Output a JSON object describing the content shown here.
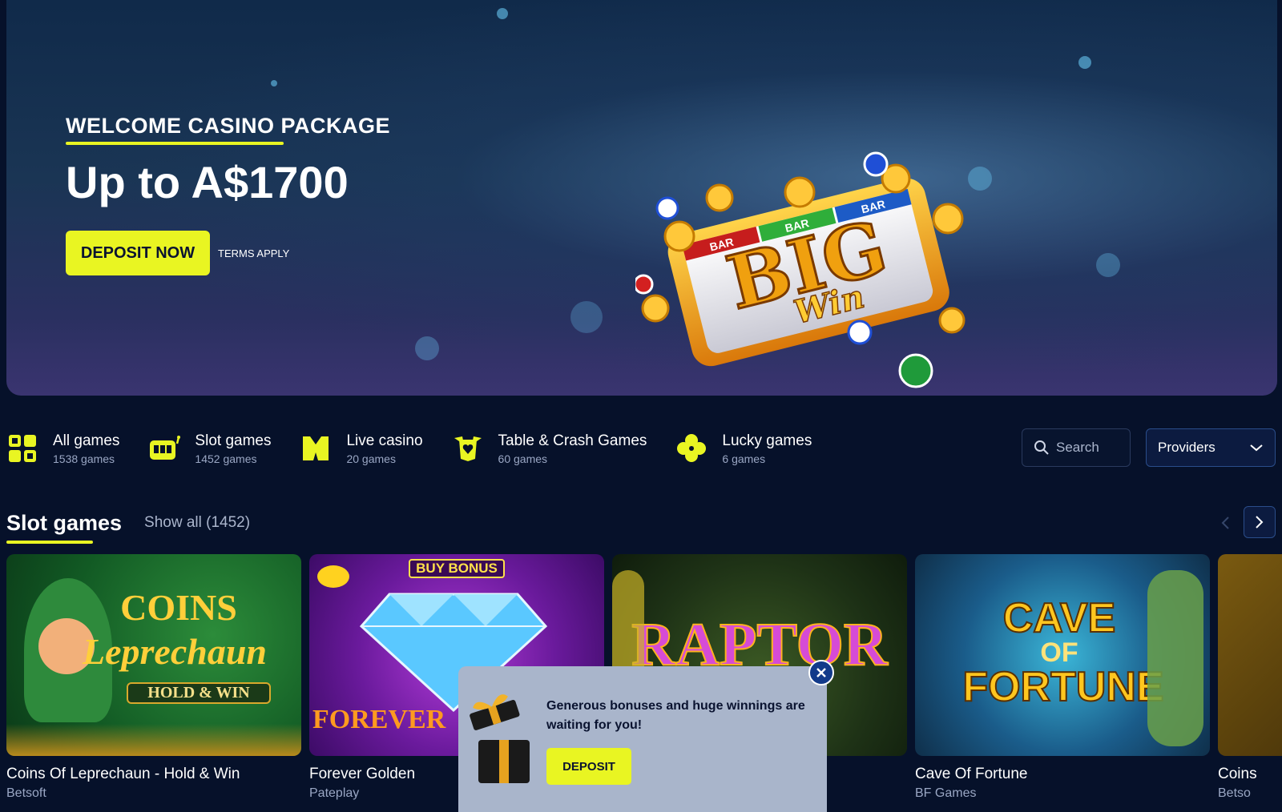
{
  "hero": {
    "kicker": "WELCOME CASINO PACKAGE",
    "title": "Up to A$1700",
    "cta_label": "DEPOSIT NOW",
    "terms": "TERMS APPLY",
    "art_text_top": "BIG",
    "art_text_bottom": "Win",
    "art_bar_label": "BAR"
  },
  "categories": [
    {
      "name": "All games",
      "count": "1538 games",
      "icon": "grid-icon"
    },
    {
      "name": "Slot games",
      "count": "1452 games",
      "icon": "slot-machine-icon"
    },
    {
      "name": "Live casino",
      "count": "20 games",
      "icon": "dealer-icon"
    },
    {
      "name": "Table & Crash Games",
      "count": "60 games",
      "icon": "card-shield-icon"
    },
    {
      "name": "Lucky games",
      "count": "6 games",
      "icon": "clover-icon"
    }
  ],
  "search": {
    "placeholder": "Search"
  },
  "providers": {
    "label": "Providers"
  },
  "section": {
    "title": "Slot games",
    "show_all": "Show all (1452)"
  },
  "games": [
    {
      "name": "Coins Of Leprechaun - Hold & Win",
      "provider": "Betsoft",
      "art": "COINS",
      "art2": "Leprechaun",
      "art3": "HOLD & WIN"
    },
    {
      "name": "Forever Golden",
      "provider": "Pateplay",
      "art": "FOREVER",
      "badge": "BUY BONUS"
    },
    {
      "name": "",
      "provider": "",
      "art": "RAPTOR"
    },
    {
      "name": "Cave Of Fortune",
      "provider": "BF Games",
      "art": "CAVE",
      "art2": "OF",
      "art3": "FORTUNE"
    },
    {
      "name": "Coins",
      "provider": "Betso"
    }
  ],
  "popup": {
    "text": "Generous bonuses and huge winnings are waiting for you!",
    "button": "DEPOSIT"
  },
  "colors": {
    "accent": "#e9f522",
    "background": "#06112a",
    "popup_bg": "#a9b5cb",
    "close_bg": "#123a8a"
  }
}
